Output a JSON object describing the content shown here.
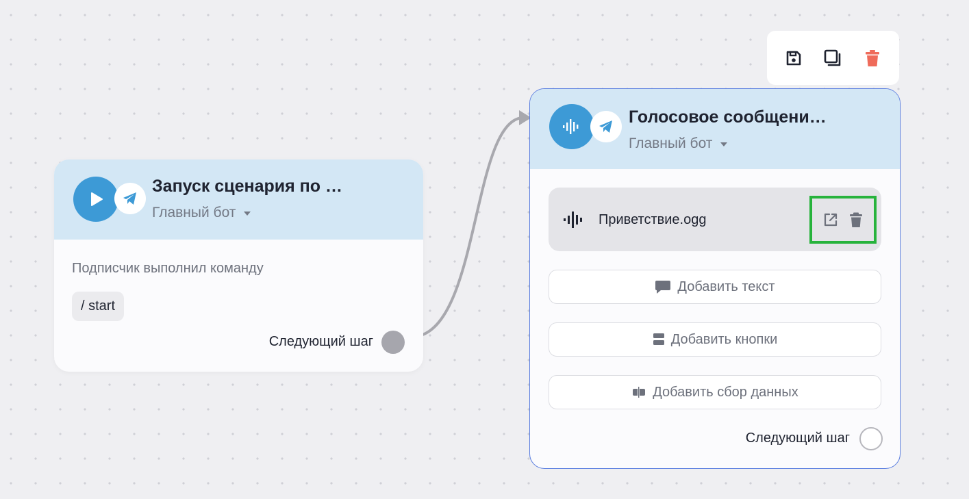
{
  "colors": {
    "accent_blue": "#3d9ad6",
    "header_bg": "#d3e7f5",
    "selected_border": "#5b7fe0",
    "delete_red": "#ef6b5a",
    "highlight_green": "#27b33c"
  },
  "trigger_node": {
    "icon": "play-icon",
    "platform_icon": "telegram-icon",
    "title": "Запуск сценария по …",
    "bot": "Главный бот",
    "trigger_text": "Подписчик выполнил команду",
    "command": "/ start",
    "next_step_label": "Следующий шаг"
  },
  "voice_node": {
    "icon": "voice-wave-icon",
    "platform_icon": "telegram-icon",
    "title": "Голосовое сообщени…",
    "bot": "Главный бот",
    "audio_file": "Приветствие.ogg",
    "add_text_label": "Добавить текст",
    "add_buttons_label": "Добавить кнопки",
    "add_data_collect_label": "Добавить сбор данных",
    "next_step_label": "Следующий шаг"
  },
  "toolbar": {
    "icons": [
      "save-icon",
      "duplicate-icon",
      "delete-icon"
    ]
  }
}
